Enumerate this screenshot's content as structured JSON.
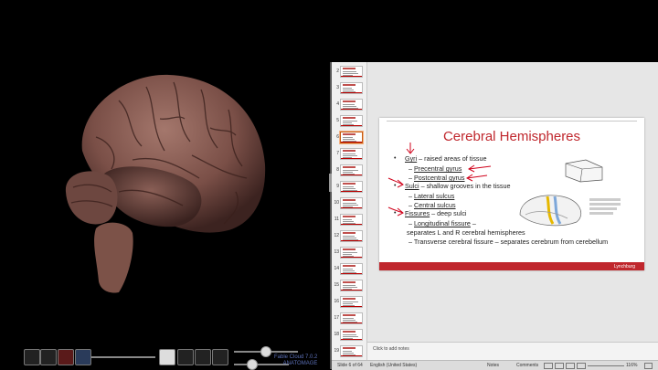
{
  "viewer": {
    "brand_line1": "Fable Cloud 7.0.2",
    "brand_line2": "ANATOMAGE"
  },
  "thumbnails": [
    {
      "num": "2"
    },
    {
      "num": "3"
    },
    {
      "num": "4"
    },
    {
      "num": "5"
    },
    {
      "num": "6"
    },
    {
      "num": "7"
    },
    {
      "num": "8"
    },
    {
      "num": "9"
    },
    {
      "num": "10"
    },
    {
      "num": "11"
    },
    {
      "num": "12"
    },
    {
      "num": "13"
    },
    {
      "num": "14"
    },
    {
      "num": "15"
    },
    {
      "num": "16"
    },
    {
      "num": "17"
    },
    {
      "num": "18"
    },
    {
      "num": "19"
    }
  ],
  "slide": {
    "title": "Cerebral Hemispheres",
    "b1_term": "Gyri",
    "b1_rest": " – raised areas of tissue",
    "b1_sub1": "Precentral gyrus",
    "b1_sub2": "Postcentral gyrus",
    "b2_term": "Sulci",
    "b2_rest": " – shallow grooves in the tissue",
    "b2_sub1": "Lateral sulcus",
    "b2_sub2": "Central sulcus",
    "b3_term": "Fissures",
    "b3_rest": " – deep sulci",
    "b3_sub1": "Longitudinal fissure",
    "b3_sub1_rest": " –",
    "b3_sub1_cont": "separates L and R cerebral hemispheres",
    "b3_sub2": "Transverse cerebral fissure – separates cerebrum from cerebellum",
    "logo": "Lynchburg"
  },
  "notes": {
    "placeholder": "Click to add notes"
  },
  "status": {
    "slide_info": "Slide 6 of 64",
    "language": "English (United States)",
    "notes_btn": "Notes",
    "comments_btn": "Comments",
    "zoom": "116%"
  },
  "colors": {
    "accent_red": "#c0272d",
    "annotation_red": "#d0021b"
  }
}
